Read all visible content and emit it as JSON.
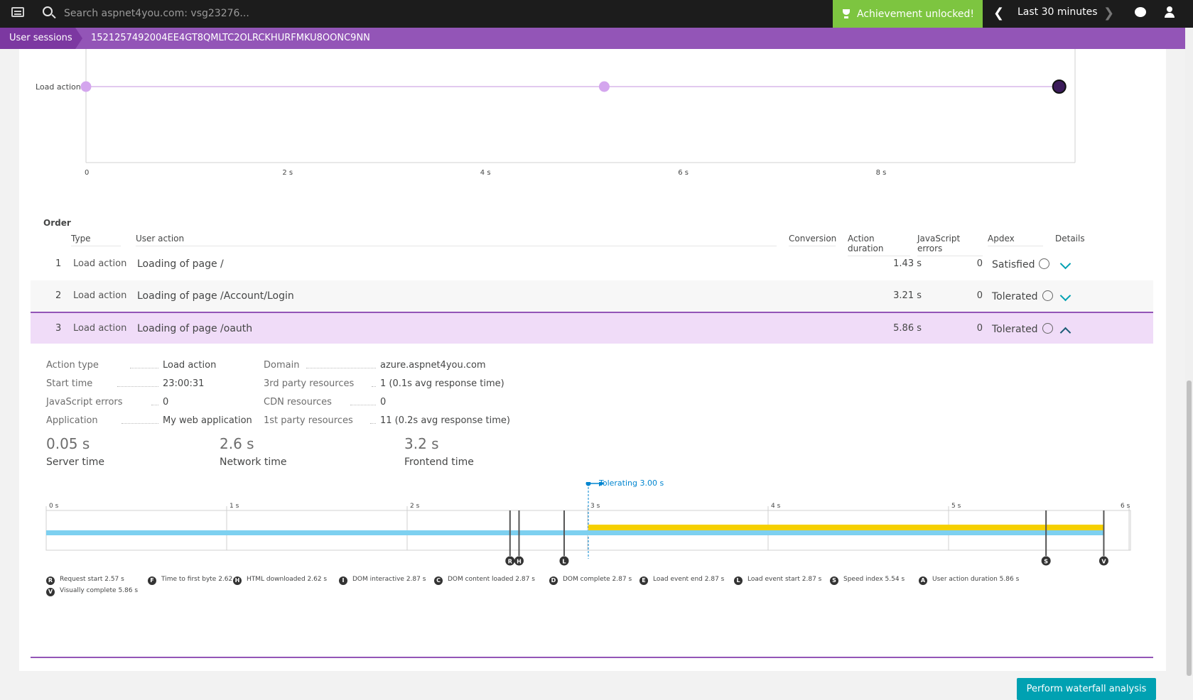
{
  "topbar": {
    "search_placeholder": "Search aspnet4you.com: vsg23276...",
    "achievement": "Achievement unlocked!",
    "timeframe": "Last 30 minutes"
  },
  "breadcrumb": {
    "first": "User sessions",
    "second": "1521257492004EE4GT8QMLTC2OLRCKHURFMKU8OONC9NN"
  },
  "timeline": {
    "row_label": "Load action",
    "ticks": [
      "0",
      "2 s",
      "4 s",
      "6 s",
      "8 s"
    ]
  },
  "chart_data": {
    "type": "scatter",
    "categories": [
      "Load action"
    ],
    "x": [
      0,
      5.24,
      9.84
    ],
    "ticks": [
      "0",
      "2 s",
      "4 s",
      "6 s",
      "8 s"
    ],
    "xlim": [
      0,
      10
    ]
  },
  "table": {
    "headers": {
      "order": "Order",
      "type": "Type",
      "action": "User action",
      "conversion": "Conversion",
      "duration": "Action duration",
      "errors": "JavaScript errors",
      "apdex": "Apdex",
      "details": "Details"
    },
    "rows": [
      {
        "num": "1",
        "type": "Load action",
        "action": "Loading of page /",
        "duration": "1.43 s",
        "errors": "0",
        "apdex": "Satisfied"
      },
      {
        "num": "2",
        "type": "Load action",
        "action": "Loading of page /Account/Login",
        "duration": "3.21 s",
        "errors": "0",
        "apdex": "Tolerated"
      },
      {
        "num": "3",
        "type": "Load action",
        "action": "Loading of page /oauth",
        "duration": "5.86 s",
        "errors": "0",
        "apdex": "Tolerated"
      }
    ]
  },
  "detail": {
    "left": [
      {
        "k": "Action type",
        "v": "Load action"
      },
      {
        "k": "Start time",
        "v": "23:00:31"
      },
      {
        "k": "JavaScript errors",
        "v": "0"
      },
      {
        "k": "Application",
        "v": "My web application"
      }
    ],
    "right": [
      {
        "k": "Domain",
        "v": "azure.aspnet4you.com"
      },
      {
        "k": "3rd party resources",
        "v": "1 (0.1s avg response time)"
      },
      {
        "k": "CDN resources",
        "v": "0"
      },
      {
        "k": "1st party resources",
        "v": "11 (0.2s avg response time)"
      }
    ],
    "metrics": [
      {
        "value": "0.05 s",
        "label": "Server time"
      },
      {
        "value": "2.6 s",
        "label": "Network time"
      },
      {
        "value": "3.2 s",
        "label": "Frontend time"
      }
    ],
    "tolerating": "Tolerating 3.00 s",
    "waterfall_ticks": [
      "0 s",
      "1 s",
      "2 s",
      "3 s",
      "4 s",
      "5 s",
      "6 s"
    ],
    "markers": [
      "R",
      "H",
      "L",
      "S",
      "V"
    ],
    "legend": [
      {
        "b": "R",
        "t": "Request start 2.57 s"
      },
      {
        "b": "F",
        "t": "Time to first byte 2.62 s"
      },
      {
        "b": "H",
        "t": "HTML downloaded 2.62 s"
      },
      {
        "b": "I",
        "t": "DOM interactive 2.87 s"
      },
      {
        "b": "C",
        "t": "DOM content loaded 2.87 s"
      },
      {
        "b": "D",
        "t": "DOM complete 2.87 s"
      },
      {
        "b": "E",
        "t": "Load event end 2.87 s"
      },
      {
        "b": "L",
        "t": "Load event start 2.87 s"
      },
      {
        "b": "S",
        "t": "Speed index 5.54 s"
      },
      {
        "b": "A",
        "t": "User action duration 5.86 s"
      },
      {
        "b": "V",
        "t": "Visually complete 5.86 s"
      }
    ],
    "button": "Perform waterfall analysis"
  },
  "colors": {
    "purple": "#9355b7",
    "teal": "#00a1b2",
    "green": "#7dc540",
    "network_bar": "#7dd0f0",
    "frontend_bar": "#f5d000"
  }
}
